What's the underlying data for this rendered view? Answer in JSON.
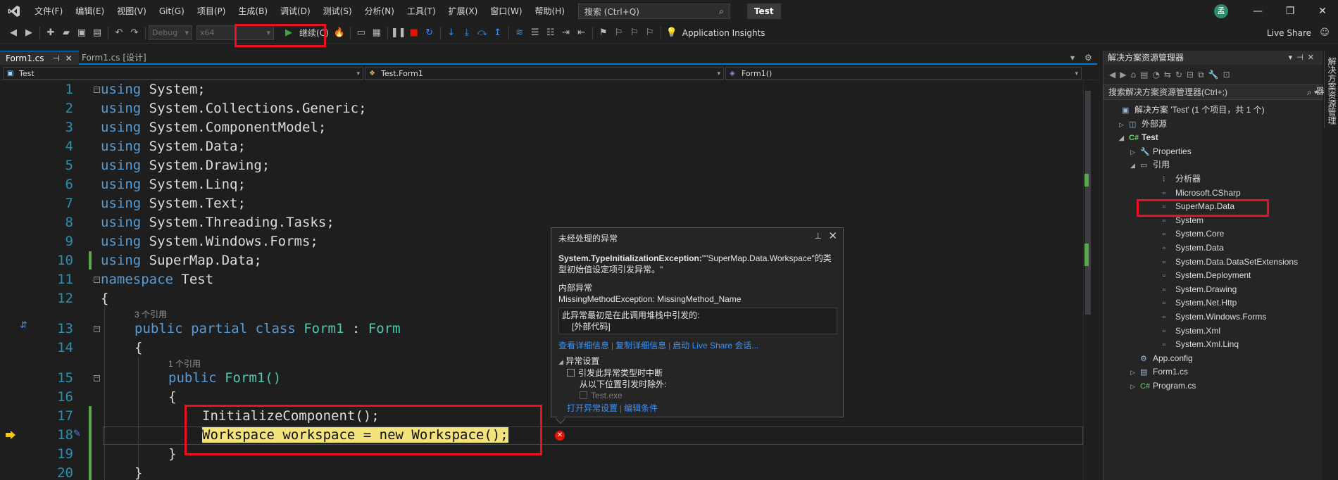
{
  "menu": {
    "items": [
      "文件(F)",
      "编辑(E)",
      "视图(V)",
      "Git(G)",
      "项目(P)",
      "生成(B)",
      "调试(D)",
      "测试(S)",
      "分析(N)",
      "工具(T)",
      "扩展(X)",
      "窗口(W)",
      "帮助(H)"
    ],
    "search_placeholder": "搜索 (Ctrl+Q)",
    "solution_name": "Test",
    "avatar_initial": "孟"
  },
  "toolbar": {
    "config": "Debug",
    "platform": "x64",
    "continue_label": "继续(C)",
    "insights_label": "Application Insights",
    "live_share_label": "Live Share"
  },
  "tabs": [
    {
      "label": "Form1.cs",
      "active": true
    },
    {
      "label": "Form1.cs [设计]",
      "active": false
    }
  ],
  "nav": {
    "project": "Test",
    "type": "Test.Form1",
    "member": "Form1()"
  },
  "code": {
    "line_numbers": [
      "1",
      "2",
      "3",
      "4",
      "5",
      "6",
      "7",
      "8",
      "9",
      "10",
      "11",
      "12",
      "13",
      "14",
      "15",
      "16",
      "17",
      "18",
      "19",
      "20"
    ],
    "refs_class": "3 个引用",
    "refs_ctor": "1 个引用",
    "lines": {
      "l1": "System;",
      "l2": "System.Collections.Generic;",
      "l3": "System.ComponentModel;",
      "l4": "System.Data;",
      "l5": "System.Drawing;",
      "l6": "System.Linq;",
      "l7": "System.Text;",
      "l8": "System.Threading.Tasks;",
      "l9": "System.Windows.Forms;",
      "l10": "SuperMap.Data;",
      "ns": "Test",
      "brace_open": "{",
      "brace_close": "}",
      "class_name": "Form1",
      "class_base": "Form",
      "ctor": "Form1()",
      "init": "InitializeComponent();",
      "stmt": "Workspace workspace = new Workspace();"
    }
  },
  "exception": {
    "title": "未经处理的异常",
    "type": "System.TypeInitializationException:",
    "message": "\"\"SuperMap.Data.Workspace\"的类型初始值设定项引发异常。\"",
    "inner_label": "内部异常",
    "inner": "MissingMethodException: MissingMethod_Name",
    "origin": "此异常最初是在此调用堆栈中引发的:",
    "external": "[外部代码]",
    "link_details": "查看详细信息",
    "link_copy": "复制详细信息",
    "link_liveshare": "启动 Live Share 会话...",
    "settings": "异常设置",
    "break_on": "引发此异常类型时中断",
    "except_from": "从以下位置引发时除外:",
    "module": "Test.exe",
    "open_settings": "打开异常设置",
    "edit_conditions": "编辑条件"
  },
  "solution_explorer": {
    "title": "解决方案资源管理器",
    "search_placeholder": "搜索解决方案资源管理器(Ctrl+;)",
    "side_tab": "解决方案资源管理器",
    "nodes": [
      {
        "label": "解决方案 'Test' (1 个项目，共 1 个)",
        "indent": 0,
        "twisty": "",
        "icon": "▣"
      },
      {
        "label": "外部源",
        "indent": 1,
        "twisty": "▷",
        "icon": "◫"
      },
      {
        "label": "Test",
        "indent": 1,
        "twisty": "◢",
        "icon": "C#"
      },
      {
        "label": "Properties",
        "indent": 2,
        "twisty": "▷",
        "icon": "🔧"
      },
      {
        "label": "引用",
        "indent": 2,
        "twisty": "◢",
        "icon": "▭"
      },
      {
        "label": "分析器",
        "indent": 3,
        "twisty": "",
        "icon": "⁝"
      },
      {
        "label": "Microsoft.CSharp",
        "indent": 3,
        "twisty": "",
        "icon": "▫"
      },
      {
        "label": "SuperMap.Data",
        "indent": 3,
        "twisty": "",
        "icon": "▫"
      },
      {
        "label": "System",
        "indent": 3,
        "twisty": "",
        "icon": "▫"
      },
      {
        "label": "System.Core",
        "indent": 3,
        "twisty": "",
        "icon": "▫"
      },
      {
        "label": "System.Data",
        "indent": 3,
        "twisty": "",
        "icon": "▫"
      },
      {
        "label": "System.Data.DataSetExtensions",
        "indent": 3,
        "twisty": "",
        "icon": "▫"
      },
      {
        "label": "System.Deployment",
        "indent": 3,
        "twisty": "",
        "icon": "▫"
      },
      {
        "label": "System.Drawing",
        "indent": 3,
        "twisty": "",
        "icon": "▫"
      },
      {
        "label": "System.Net.Http",
        "indent": 3,
        "twisty": "",
        "icon": "▫"
      },
      {
        "label": "System.Windows.Forms",
        "indent": 3,
        "twisty": "",
        "icon": "▫"
      },
      {
        "label": "System.Xml",
        "indent": 3,
        "twisty": "",
        "icon": "▫"
      },
      {
        "label": "System.Xml.Linq",
        "indent": 3,
        "twisty": "",
        "icon": "▫"
      },
      {
        "label": "App.config",
        "indent": 2,
        "twisty": "",
        "icon": "⚙"
      },
      {
        "label": "Form1.cs",
        "indent": 2,
        "twisty": "▷",
        "icon": "▤"
      },
      {
        "label": "Program.cs",
        "indent": 2,
        "twisty": "▷",
        "icon": "C#"
      }
    ]
  }
}
